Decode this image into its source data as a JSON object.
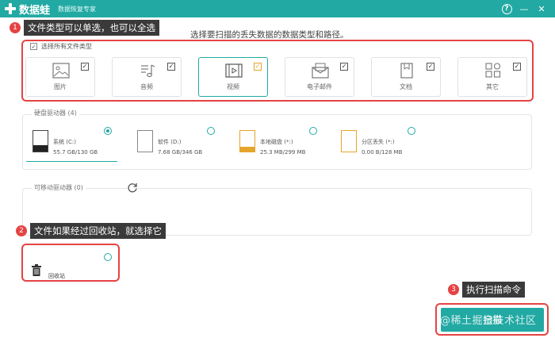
{
  "app": {
    "name": "数据蛙",
    "subtitle": "数据恢复专家",
    "help_icon": "question-circle-icon",
    "minimize_icon": "minimize-icon",
    "close_icon": "close-icon",
    "help_glyph": "?",
    "minimize_glyph": "—",
    "close_glyph": "✕"
  },
  "annotations": [
    {
      "number": "1",
      "text": "文件类型可以单选，也可以全选"
    },
    {
      "number": "2",
      "text": "文件如果经过回收站，就选择它"
    },
    {
      "number": "3",
      "text": "执行扫描命令"
    }
  ],
  "prompt": "选择要扫描的丢失数据的数据类型和路径。",
  "file_types": {
    "select_all_label": "选择所有文件类型",
    "select_all_checked": true,
    "items": [
      {
        "label": "图片",
        "icon": "image-icon",
        "checked": true
      },
      {
        "label": "音频",
        "icon": "music-icon",
        "checked": true
      },
      {
        "label": "视频",
        "icon": "video-icon",
        "checked": true,
        "selected": true
      },
      {
        "label": "电子邮件",
        "icon": "email-icon",
        "checked": true
      },
      {
        "label": "文档",
        "icon": "document-icon",
        "checked": true
      },
      {
        "label": "其它",
        "icon": "other-icon",
        "checked": true
      }
    ]
  },
  "hard_drives": {
    "title": "硬盘驱动器 (4)",
    "items": [
      {
        "name": "系统 (C:)",
        "size": "55.7 GB/130 GB",
        "selected": true,
        "icon": "system-drive-icon"
      },
      {
        "name": "软件 (D:)",
        "size": "7.68 GB/346 GB",
        "selected": false,
        "icon": "drive-icon"
      },
      {
        "name": "本地磁盘 (*:)",
        "size": "25.3 MB/299 MB",
        "selected": false,
        "icon": "drive-icon"
      },
      {
        "name": "分区丢失 (*:)",
        "size": "0.00  B/128 MB",
        "selected": false,
        "icon": "drive-icon"
      }
    ]
  },
  "removable_drives": {
    "title": "可移动驱动器 (0)",
    "refresh_icon": "refresh-icon"
  },
  "recycle_bin": {
    "label": "回收站",
    "icon": "trash-icon"
  },
  "scan_button": {
    "label": "扫描"
  },
  "watermark": "@稀土掘金技术社区",
  "colors": {
    "brand": "#22a9a3",
    "annotation_red": "#e54343",
    "tip_dark": "#3a3a3a",
    "drive_orange": "#e5a52a"
  }
}
